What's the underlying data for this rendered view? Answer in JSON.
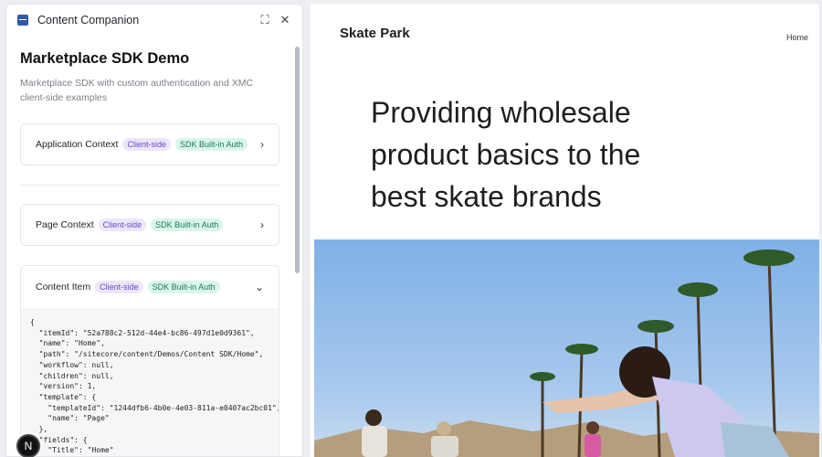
{
  "panel": {
    "title": "Content Companion",
    "heading": "Marketplace SDK Demo",
    "description": "Marketplace SDK with custom authentication and XMC client-side examples",
    "cards": [
      {
        "title": "Application Context",
        "tag1": "Client-side",
        "tag2": "SDK Built-in Auth",
        "icon": "chevron-right-icon"
      },
      {
        "title": "Page Context",
        "tag1": "Client-side",
        "tag2": "SDK Built-in Auth",
        "icon": "chevron-right-icon"
      },
      {
        "title": "Content Item",
        "tag1": "Client-side",
        "tag2": "SDK Built-in Auth",
        "icon": "chevron-down-icon"
      }
    ],
    "code": "{\n  \"itemId\": \"52a788c2-512d-44e4-bc86-497d1e0d9361\",\n  \"name\": \"Home\",\n  \"path\": \"/sitecore/content/Demos/Content SDK/Home\",\n  \"workflow\": null,\n  \"children\": null,\n  \"version\": 1,\n  \"template\": {\n    \"templateId\": \"1244dfb6-4b0e-4e03-811a-e0407ac2bc01\",\n    \"name\": \"Page\"\n  },\n  \"fields\": {\n    \"Title\": \"Home\""
  },
  "badge": "N",
  "site": {
    "logo": "Skate Park",
    "nav_home": "Home",
    "hero": "Providing wholesale product basics to the best skate brands"
  },
  "colors": {
    "accent": "#2e5aa8",
    "tag_client": "#6a47c9",
    "tag_sdk": "#1c7a55",
    "sky": "#8db6e8"
  }
}
